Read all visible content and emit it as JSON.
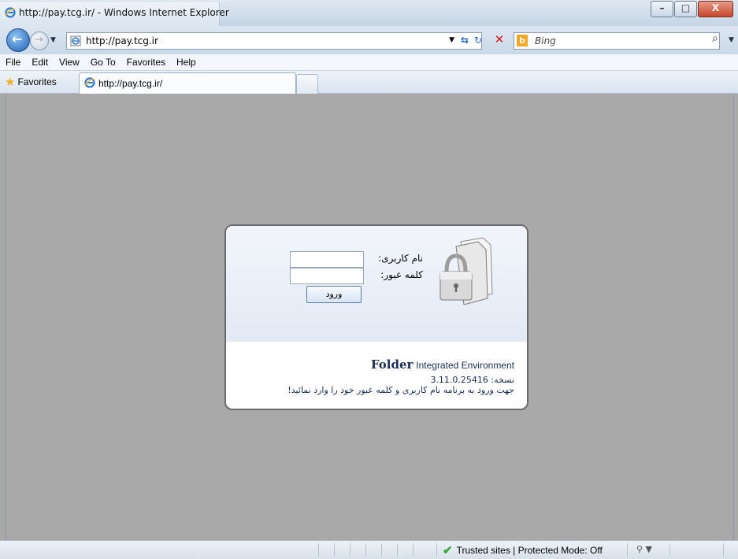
{
  "window": {
    "title": "http://pay.tcg.ir/ - Windows Internet Explorer",
    "controls": {
      "minimize": "–",
      "maximize": "□",
      "close": "X"
    }
  },
  "address_bar": {
    "url": "http://pay.tcg.ir",
    "search_placeholder": "Bing"
  },
  "menu": [
    "File",
    "Edit",
    "View",
    "Go To",
    "Favorites",
    "Help"
  ],
  "favorites_label": "Favorites",
  "tab": {
    "title": "http://pay.tcg.ir/"
  },
  "login": {
    "username_label": "نام کاربری:",
    "password_label": "کلمه عبور:",
    "submit_label": "ورود",
    "brand_bold": "Folder",
    "brand_rest": "Integrated Environment",
    "version": "نسخه: 3.11.0.25416",
    "hint": "جهت ورود به برنامه نام کاربری و کلمه عبور خود را وارد نمائید!"
  },
  "status": {
    "zone": "Trusted sites | Protected Mode: Off"
  },
  "colors": {
    "page_bg": "#a9a9a9",
    "panel_top": "#e3e9f5",
    "brand": "#1a2d55"
  }
}
